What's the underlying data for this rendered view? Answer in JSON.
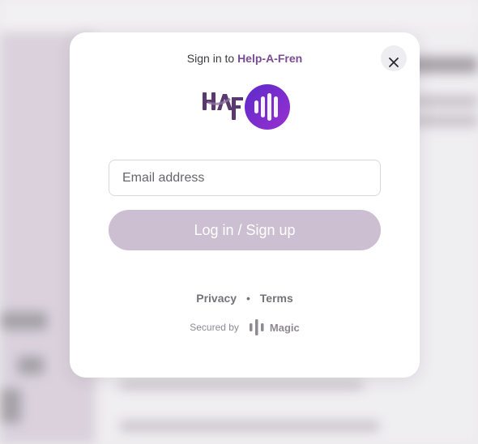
{
  "modal": {
    "signin_prefix": "Sign in to",
    "app_name": "Help-A-Fren",
    "email_placeholder": "Email address",
    "email_value": "",
    "login_label": "Log in / Sign up",
    "privacy_label": "Privacy",
    "separator": "•",
    "terms_label": "Terms",
    "secured_by": "Secured by",
    "provider_name": "Magic"
  },
  "colors": {
    "accent": "#7a4c93",
    "button_disabled": "#cbbfd1",
    "logo_circle_start": "#5b2bc9",
    "logo_circle_end": "#9a2fd0"
  }
}
